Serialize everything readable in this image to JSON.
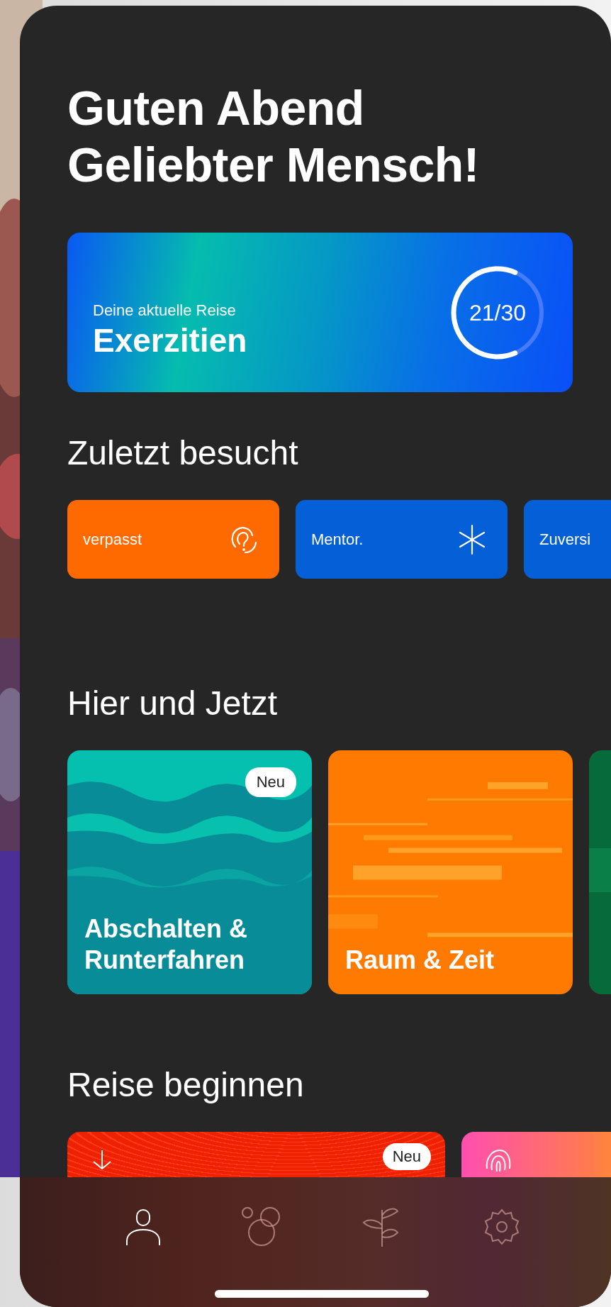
{
  "greeting": [
    "Guten Abend",
    "Geliebter Mensch!"
  ],
  "journey": {
    "subtitle": "Deine aktuelle Reise",
    "title": "Exerzitien",
    "progress": {
      "text": "21/30",
      "level": 0.7
    }
  },
  "recent": {
    "title": "Zuletzt besucht",
    "items": [
      {
        "label": "verpasst",
        "color": "#ff6a00",
        "kind": "ear"
      },
      {
        "label": "Mentor.",
        "color": "#0560d8",
        "kind": "asterisk"
      },
      {
        "label": "Zuversi",
        "color": "#0560d8",
        "kind": "none"
      }
    ]
  },
  "here_and_now": {
    "title": "Hier und Jetzt",
    "cards": [
      {
        "kind": "waves",
        "title": "Abschalten & Runterfahren",
        "badge": "Neu"
      },
      {
        "kind": "lines",
        "title": "Raum & Zeit"
      },
      {
        "kind": "green"
      }
    ]
  },
  "start_journey": {
    "title": "Reise beginnen",
    "cards": [
      {
        "kind": "red",
        "badge": "Neu"
      },
      {
        "kind": "pink"
      }
    ]
  },
  "tabs": [
    {
      "kind": "profile",
      "selected": true
    },
    {
      "kind": "bubbles",
      "selected": false
    },
    {
      "kind": "plant",
      "selected": false
    },
    {
      "kind": "settings",
      "selected": false
    }
  ]
}
